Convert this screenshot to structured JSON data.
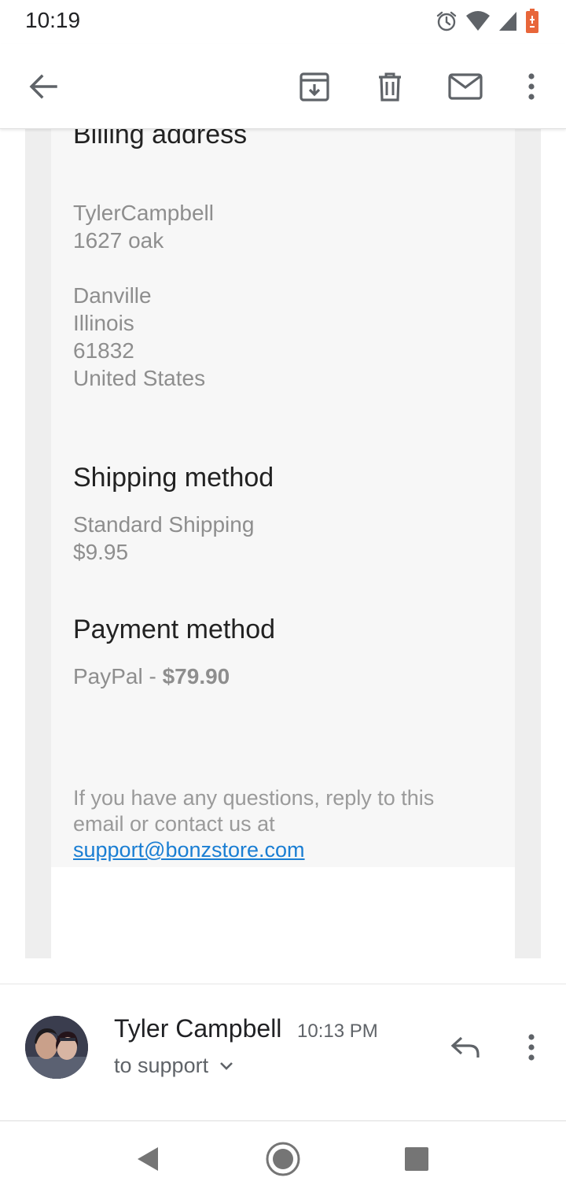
{
  "status_bar": {
    "time": "10:19",
    "icons": [
      "alarm-icon",
      "wifi-icon",
      "signal-icon",
      "battery-icon"
    ]
  },
  "app_bar": {
    "icons": [
      "back-arrow-icon",
      "archive-icon",
      "delete-icon",
      "mark-unread-icon",
      "more-vert-icon"
    ]
  },
  "email": {
    "billing": {
      "heading": "Billing address",
      "name": "TylerCampbell",
      "street": "1627 oak",
      "city": "Danville",
      "state": "Illinois",
      "zip": "61832",
      "country": "United States"
    },
    "shipping": {
      "heading": "Shipping method",
      "method": "Standard Shipping",
      "price": "$9.95"
    },
    "payment": {
      "heading": "Payment method",
      "method": "PayPal - ",
      "amount": "$79.90"
    },
    "footer": {
      "text": "If you have any questions, reply to this email or contact us at ",
      "link": "support@bonzstore.com"
    }
  },
  "message_header": {
    "sender": "Tyler Campbell",
    "time": "10:13 PM",
    "recipient": "to support"
  },
  "colors": {
    "link": "#1a7ed3",
    "card_outer": "#eeeeee",
    "card_inner": "#f7f7f7",
    "muted_text": "#8e8e8e",
    "battery": "#e8663a"
  }
}
